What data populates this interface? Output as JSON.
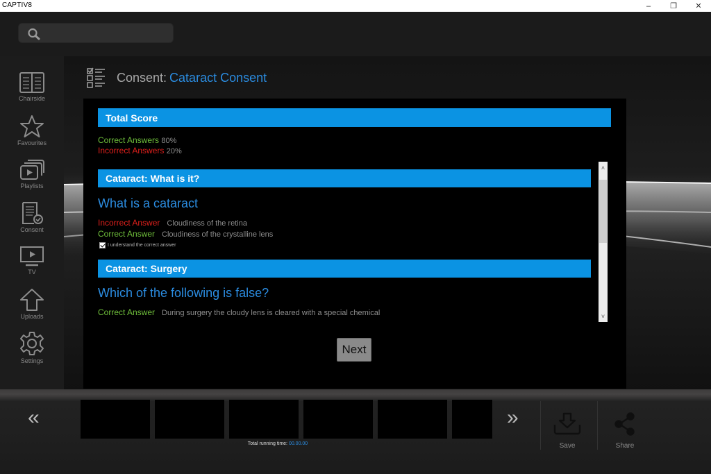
{
  "window": {
    "title": "CAPTIV8",
    "controls": {
      "minimize": "–",
      "maximize": "❐",
      "close": "✕"
    }
  },
  "search": {
    "value": "",
    "placeholder": "",
    "icon": "search-icon"
  },
  "sidebar": {
    "items": [
      {
        "label": "Chairside",
        "icon": "book-icon"
      },
      {
        "label": "Favourites",
        "icon": "star-icon"
      },
      {
        "label": "Playlists",
        "icon": "playlist-icon"
      },
      {
        "label": "Consent",
        "icon": "consent-document-icon"
      },
      {
        "label": "TV",
        "icon": "tv-icon"
      },
      {
        "label": "Uploads",
        "icon": "upload-arrow-icon"
      },
      {
        "label": "Settings",
        "icon": "gear-icon"
      }
    ]
  },
  "header": {
    "prefix": "Consent:",
    "name": "Cataract Consent",
    "icon": "checklist-icon"
  },
  "colors": {
    "accent": "#0b93e3",
    "title_blue": "#2b8ce0",
    "correct": "#6fbf3b",
    "incorrect": "#e0201c"
  },
  "score": {
    "title": "Total Score",
    "correct_label": "Correct Answers",
    "correct_value": "80%",
    "incorrect_label": "Incorrect Answers",
    "incorrect_value": "20%"
  },
  "sections": [
    {
      "title": "Cataract: What is it?",
      "question": "What is a cataract",
      "answers": [
        {
          "label": "Incorrect Answer",
          "text": "Cloudiness of the retina",
          "type": "incorrect"
        },
        {
          "label": "Correct Answer",
          "text": "Cloudiness of the crystalline lens",
          "type": "correct"
        }
      ],
      "acknowledge": {
        "label": "I understand the correct answer",
        "checked": true
      }
    },
    {
      "title": "Cataract: Surgery",
      "question": "Which of the following is false?",
      "answers": [
        {
          "label": "Correct Answer",
          "text": "During surgery the cloudy lens is cleared with a special chemical",
          "type": "correct"
        }
      ]
    }
  ],
  "scrollbar": {
    "up": "˄",
    "down": "˅"
  },
  "next_label": "Next",
  "bottom": {
    "prev": "«",
    "next": "»",
    "runtime_label": "Total running time:",
    "runtime_value": "00.00.00",
    "save_label": "Save",
    "share_label": "Share"
  }
}
